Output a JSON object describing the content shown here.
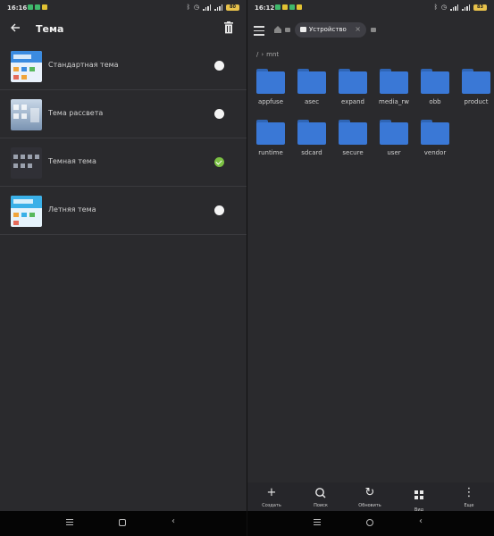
{
  "left_screen": {
    "status_bar": {
      "time": "16:16",
      "battery": "80"
    },
    "header": {
      "title": "Тема"
    },
    "themes": [
      {
        "label": "Стандартная тема",
        "selected": false
      },
      {
        "label": "Тема рассвета",
        "selected": false
      },
      {
        "label": "Темная тема",
        "selected": true
      },
      {
        "label": "Летняя тема",
        "selected": false
      }
    ]
  },
  "right_screen": {
    "status_bar": {
      "time": "16:12",
      "battery": "83"
    },
    "tab": {
      "label": "Устройство"
    },
    "breadcrumb": {
      "root": "/",
      "current": "mnt"
    },
    "folders": [
      "appfuse",
      "asec",
      "expand",
      "media_rw",
      "obb",
      "product",
      "runtime",
      "sdcard",
      "secure",
      "user",
      "vendor"
    ],
    "toolbar": [
      {
        "icon": "plus-icon",
        "label": "Создать"
      },
      {
        "icon": "search-icon",
        "label": "Поиск"
      },
      {
        "icon": "refresh-icon",
        "label": "Обновить"
      },
      {
        "icon": "grid-view-icon",
        "label": "Вид"
      },
      {
        "icon": "more-vertical-icon",
        "label": "Еще"
      }
    ]
  },
  "colors": {
    "background": "#2a2a2d",
    "folder_blue": "#3a78d6",
    "selected_green": "#7bc043",
    "battery": "#e8c24b"
  }
}
